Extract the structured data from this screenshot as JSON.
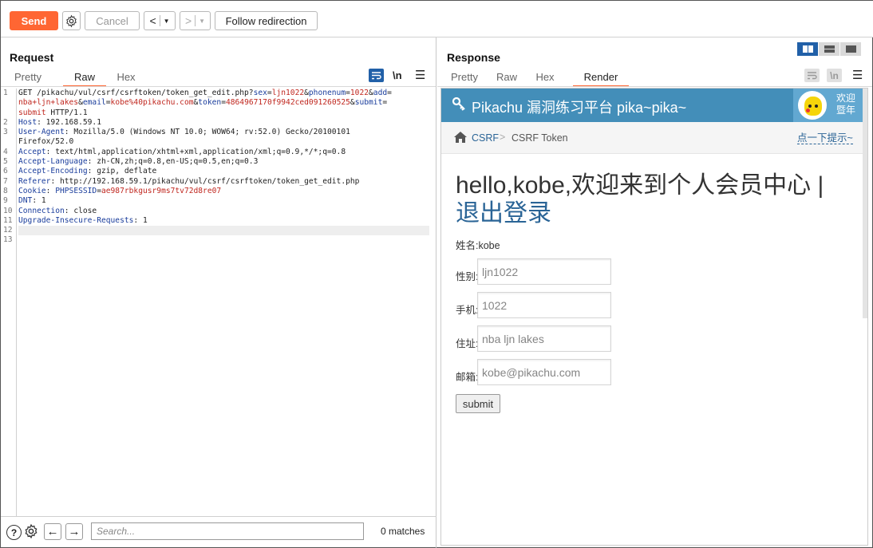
{
  "toolbar": {
    "send_label": "Send",
    "cancel_label": "Cancel",
    "back_label": "<",
    "forward_label": ">",
    "follow_label": "Follow redirection"
  },
  "request": {
    "title": "Request",
    "tabs": [
      {
        "label": "Pretty",
        "active": false
      },
      {
        "label": "Raw",
        "active": true
      },
      {
        "label": "Hex",
        "active": false
      }
    ],
    "newline_toggle": "\\n",
    "line_numbers": [
      "1",
      "",
      "",
      "2",
      "3",
      "",
      "4",
      "5",
      "6",
      "7",
      "8",
      "9",
      "10",
      "11",
      "12",
      "13"
    ],
    "lines": [
      {
        "parts": [
          [
            "t",
            "GET /pikachu/vul/csrf/csrftoken/token_get_edit.php?"
          ],
          [
            "k",
            "sex"
          ],
          [
            "t",
            "="
          ],
          [
            "v",
            "ljn1022"
          ],
          [
            "t",
            "&"
          ],
          [
            "k",
            "phonenum"
          ],
          [
            "t",
            "="
          ],
          [
            "v",
            "1022"
          ],
          [
            "t",
            "&"
          ],
          [
            "k",
            "add"
          ],
          [
            "t",
            "="
          ]
        ]
      },
      {
        "parts": [
          [
            "v",
            "nba+ljn+lakes"
          ],
          [
            "t",
            "&"
          ],
          [
            "k",
            "email"
          ],
          [
            "t",
            "="
          ],
          [
            "v",
            "kobe%40pikachu.com"
          ],
          [
            "t",
            "&"
          ],
          [
            "k",
            "token"
          ],
          [
            "t",
            "="
          ],
          [
            "v",
            "4864967170f9942ced091260525"
          ],
          [
            "t",
            "&"
          ],
          [
            "k",
            "submit"
          ],
          [
            "t",
            "="
          ]
        ]
      },
      {
        "parts": [
          [
            "v",
            "submit"
          ],
          [
            "t",
            " HTTP/1.1"
          ]
        ]
      },
      {
        "parts": [
          [
            "k",
            "Host"
          ],
          [
            "t",
            ": 192.168.59.1"
          ]
        ]
      },
      {
        "parts": [
          [
            "k",
            "User-Agent"
          ],
          [
            "t",
            ": Mozilla/5.0 (Windows NT 10.0; WOW64; rv:52.0) Gecko/20100101"
          ]
        ]
      },
      {
        "parts": [
          [
            "t",
            "Firefox/52.0"
          ]
        ]
      },
      {
        "parts": [
          [
            "k",
            "Accept"
          ],
          [
            "t",
            ": text/html,application/xhtml+xml,application/xml;q=0.9,*/*;q=0.8"
          ]
        ]
      },
      {
        "parts": [
          [
            "k",
            "Accept-Language"
          ],
          [
            "t",
            ": zh-CN,zh;q=0.8,en-US;q=0.5,en;q=0.3"
          ]
        ]
      },
      {
        "parts": [
          [
            "k",
            "Accept-Encoding"
          ],
          [
            "t",
            ": gzip, deflate"
          ]
        ]
      },
      {
        "parts": [
          [
            "k",
            "Referer"
          ],
          [
            "t",
            ": http://192.168.59.1/pikachu/vul/csrf/csrftoken/token_get_edit.php"
          ]
        ]
      },
      {
        "parts": [
          [
            "k",
            "Cookie"
          ],
          [
            "t",
            ": "
          ],
          [
            "k",
            "PHPSESSID"
          ],
          [
            "t",
            "="
          ],
          [
            "v",
            "ae987rbkgusr9ms7tv72d8re07"
          ]
        ]
      },
      {
        "parts": [
          [
            "k",
            "DNT"
          ],
          [
            "t",
            ": 1"
          ]
        ]
      },
      {
        "parts": [
          [
            "k",
            "Connection"
          ],
          [
            "t",
            ": close"
          ]
        ]
      },
      {
        "parts": [
          [
            "k",
            "Upgrade-Insecure-Requests"
          ],
          [
            "t",
            ": 1"
          ]
        ]
      },
      {
        "parts": [
          [
            "t",
            ""
          ]
        ],
        "highlight": true
      },
      {
        "parts": [
          [
            "t",
            ""
          ]
        ]
      }
    ],
    "search_placeholder": "Search...",
    "matches": "0 matches"
  },
  "response": {
    "title": "Response",
    "tabs": [
      {
        "label": "Pretty",
        "active": false
      },
      {
        "label": "Raw",
        "active": false
      },
      {
        "label": "Hex",
        "active": false
      },
      {
        "label": "Render",
        "active": true
      }
    ],
    "newline_toggle": "\\n"
  },
  "page": {
    "header_title": "Pikachu 漏洞练习平台 pika~pika~",
    "welcome_line1": "欢迎",
    "welcome_line2": "暨年",
    "breadcrumb": {
      "csrf": "CSRF",
      "separator": ">",
      "current": "CSRF Token",
      "hint": "点一下提示~"
    },
    "hello_text": "hello,kobe,欢迎来到个人会员中心 | ",
    "logout_text": "退出登录",
    "name_row": "姓名:kobe",
    "fields": [
      {
        "label": "性别:",
        "value": "ljn1022"
      },
      {
        "label": "手机:",
        "value": "1022"
      },
      {
        "label": "住址:",
        "value": "nba ljn lakes"
      },
      {
        "label": "邮箱:",
        "value": "kobe@pikachu.com"
      }
    ],
    "submit_label": "submit"
  },
  "colors": {
    "accent": "#ff6633",
    "header_blue": "#438eb9",
    "link_blue": "#2a6496",
    "toggle_blue": "#2160a8"
  }
}
